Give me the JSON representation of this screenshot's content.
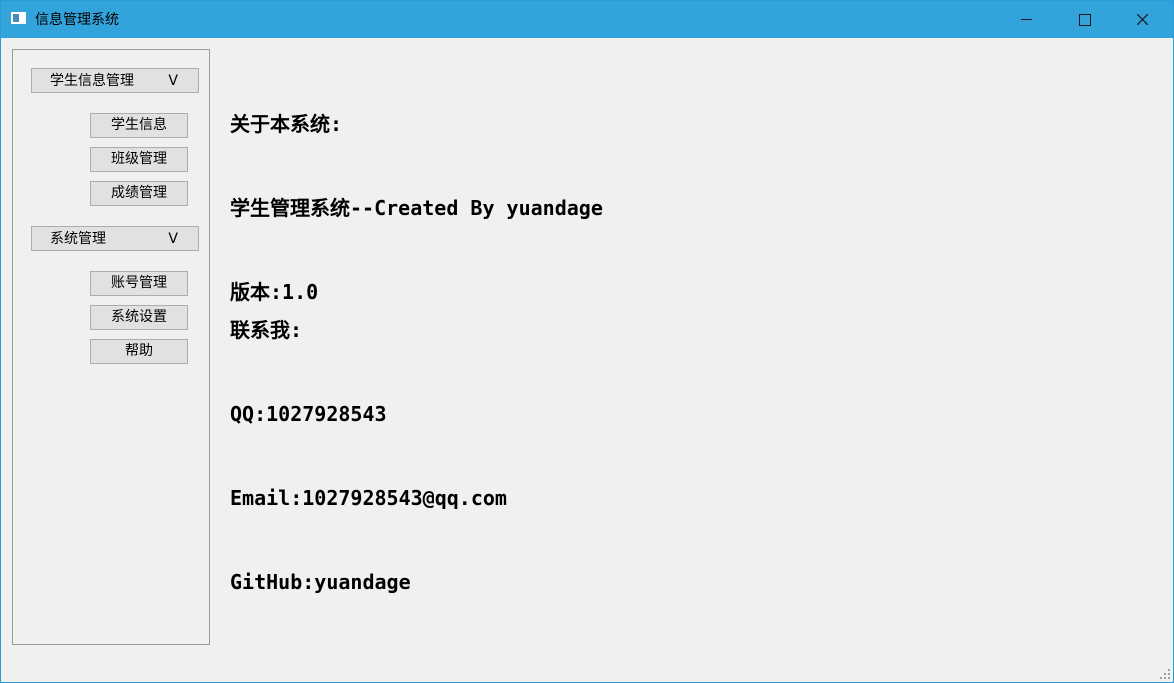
{
  "window": {
    "title": "信息管理系统",
    "accent_color": "#33a3dc",
    "controls": [
      "minimize-icon",
      "maximize-icon",
      "close-icon"
    ]
  },
  "sidebar": {
    "groups": [
      {
        "label": "学生信息管理",
        "chevron": "V",
        "items": [
          "学生信息",
          "班级管理",
          "成绩管理"
        ]
      },
      {
        "label": "系统管理",
        "chevron": "V",
        "items": [
          "账号管理",
          "系统设置",
          "帮助"
        ]
      }
    ]
  },
  "about": {
    "heading": "关于本系统:",
    "name_line": "学生管理系统--Created By yuandage",
    "version": "版本:1.0",
    "contact_heading": "联系我:",
    "qq": "QQ:1027928543",
    "email": "Email:1027928543@qq.com",
    "github": "GitHub:yuandage"
  }
}
